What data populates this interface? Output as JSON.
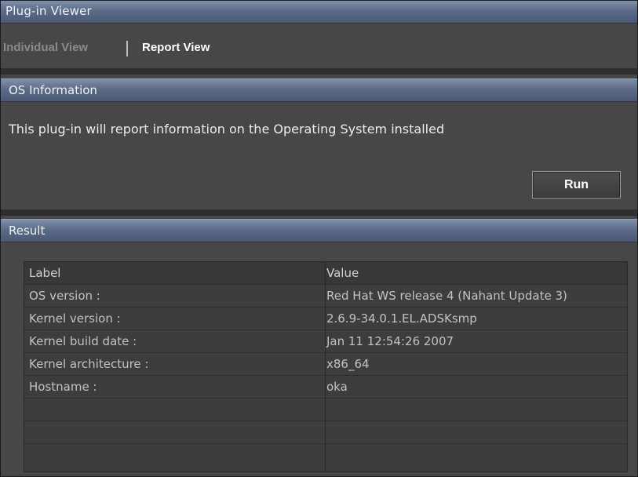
{
  "window": {
    "title": "Plug-in Viewer"
  },
  "tabs": [
    {
      "label": "Individual View",
      "active": false
    },
    {
      "label": "Report View",
      "active": true
    }
  ],
  "os_section": {
    "title": "OS Information",
    "description": "This plug-in will report information on the Operating System installed",
    "run_label": "Run"
  },
  "result_section": {
    "title": "Result",
    "columns": [
      "Label",
      "Value"
    ],
    "rows": [
      [
        "OS version :",
        "Red Hat WS release 4 (Nahant Update 3)"
      ],
      [
        "Kernel version :",
        "2.6.9-34.0.1.EL.ADSKsmp"
      ],
      [
        "Kernel build date :",
        "Jan 11 12:54:26 2007"
      ],
      [
        "Kernel architecture :",
        "x86_64"
      ],
      [
        "Hostname :",
        "oka"
      ],
      [
        "",
        ""
      ],
      [
        "",
        ""
      ]
    ]
  },
  "colors": {
    "header_gradient_top": "#7f8fa8",
    "header_gradient_bottom": "#4a5874",
    "panel_bg": "#474747",
    "table_bg": "#3d3d3d"
  }
}
